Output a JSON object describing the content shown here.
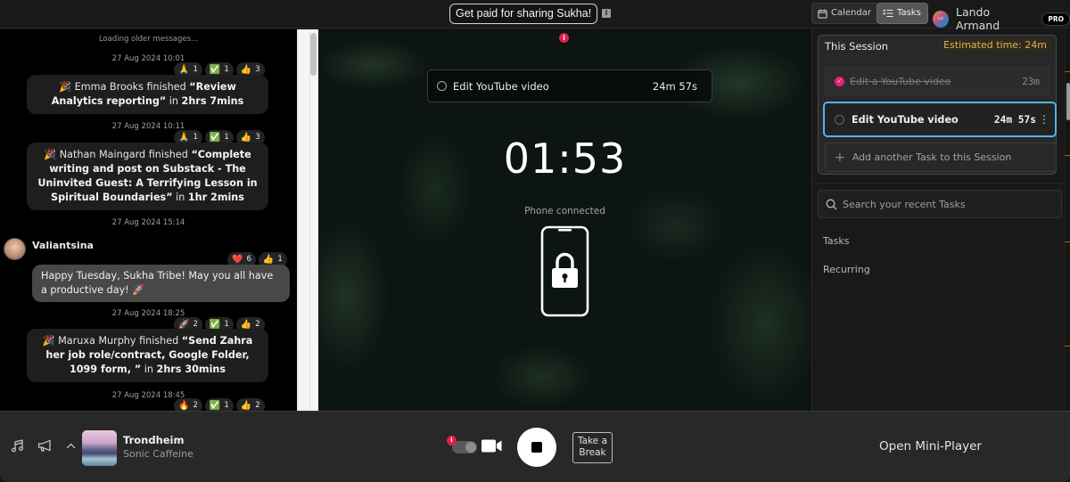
{
  "topbar": {
    "promo_label": "Get paid for sharing Sukha!",
    "promo_info_icon": "info-icon",
    "calendar_label": "Calendar",
    "tasks_label": "Tasks",
    "user_initials": "LA",
    "user_name": "Lando Armand",
    "plan_badge": "PRO"
  },
  "chat": {
    "loading_text": "Loading older messages...",
    "messages": [
      {
        "type": "completion",
        "date": "27 Aug 2024 10:01",
        "emoji": "🎉",
        "user": "Emma Brooks",
        "verb": "finished",
        "task": "“Review Analytics reporting”",
        "in": "in",
        "duration": "2hrs 7mins",
        "reactions": [
          {
            "emoji": "🙏",
            "count": "1"
          },
          {
            "emoji": "✅",
            "count": "1"
          },
          {
            "emoji": "👍",
            "count": "3"
          }
        ]
      },
      {
        "type": "completion",
        "date": "27 Aug 2024 10:11",
        "emoji": "🎉",
        "user": "Nathan Maingard",
        "verb": "finished",
        "task": "“Complete writing and post on Substack - The Uninvited Guest: A Terrifying Lesson in Spiritual Boundaries”",
        "in": "in",
        "duration": "1hr 2mins",
        "reactions": [
          {
            "emoji": "🙏",
            "count": "1"
          },
          {
            "emoji": "✅",
            "count": "1"
          },
          {
            "emoji": "👍",
            "count": "3"
          }
        ]
      },
      {
        "type": "user",
        "date": "27 Aug 2024 15:14",
        "user": "Valiantsina",
        "text": "Happy Tuesday, Sukha Tribe! May you all have a productive day! 🚀",
        "reactions": [
          {
            "emoji": "❤️",
            "count": "6"
          },
          {
            "emoji": "👍",
            "count": "1"
          }
        ]
      },
      {
        "type": "completion",
        "date": "27 Aug 2024 18:25",
        "emoji": "🎉",
        "user": "Maruxa Murphy",
        "verb": "finished",
        "task": "“Send Zahra her job role/contract, Google Folder, 1099 form, ”",
        "in": "in",
        "duration": "2hrs 30mins",
        "reactions": [
          {
            "emoji": "🚀",
            "count": "2"
          },
          {
            "emoji": "✅",
            "count": "1"
          },
          {
            "emoji": "👍",
            "count": "2"
          }
        ]
      },
      {
        "type": "completion",
        "date": "27 Aug 2024 18:45",
        "reactions": [
          {
            "emoji": "🔥",
            "count": "2"
          },
          {
            "emoji": "✅",
            "count": "1"
          },
          {
            "emoji": "👍",
            "count": "2"
          }
        ]
      }
    ]
  },
  "focus": {
    "current_task": "Edit YouTube video",
    "current_task_time": "24m 57s",
    "timer": "01:53",
    "phone_status": "Phone connected"
  },
  "session": {
    "title": "This Session",
    "estimated_time": "Estimated time: 24m",
    "tasks": [
      {
        "label": "Edit a YouTube video",
        "time": "23m",
        "done": true
      },
      {
        "label": "Edit YouTube video",
        "time": "24m 57s",
        "done": false,
        "active": true
      }
    ],
    "add_task_label": "Add another Task to this Session",
    "search_placeholder": "Search your recent Tasks",
    "nav": [
      "Tasks",
      "Recurring"
    ]
  },
  "player": {
    "track_title": "Trondheim",
    "track_artist": "Sonic Caffeine",
    "take_break_label": "Take a Break",
    "mini_player_label": "Open Mini-Player"
  },
  "colors": {
    "accent_active": "#4fb5e8",
    "done_check": "#e0217a",
    "estimate": "#e0b453",
    "alert": "#e0204a"
  }
}
